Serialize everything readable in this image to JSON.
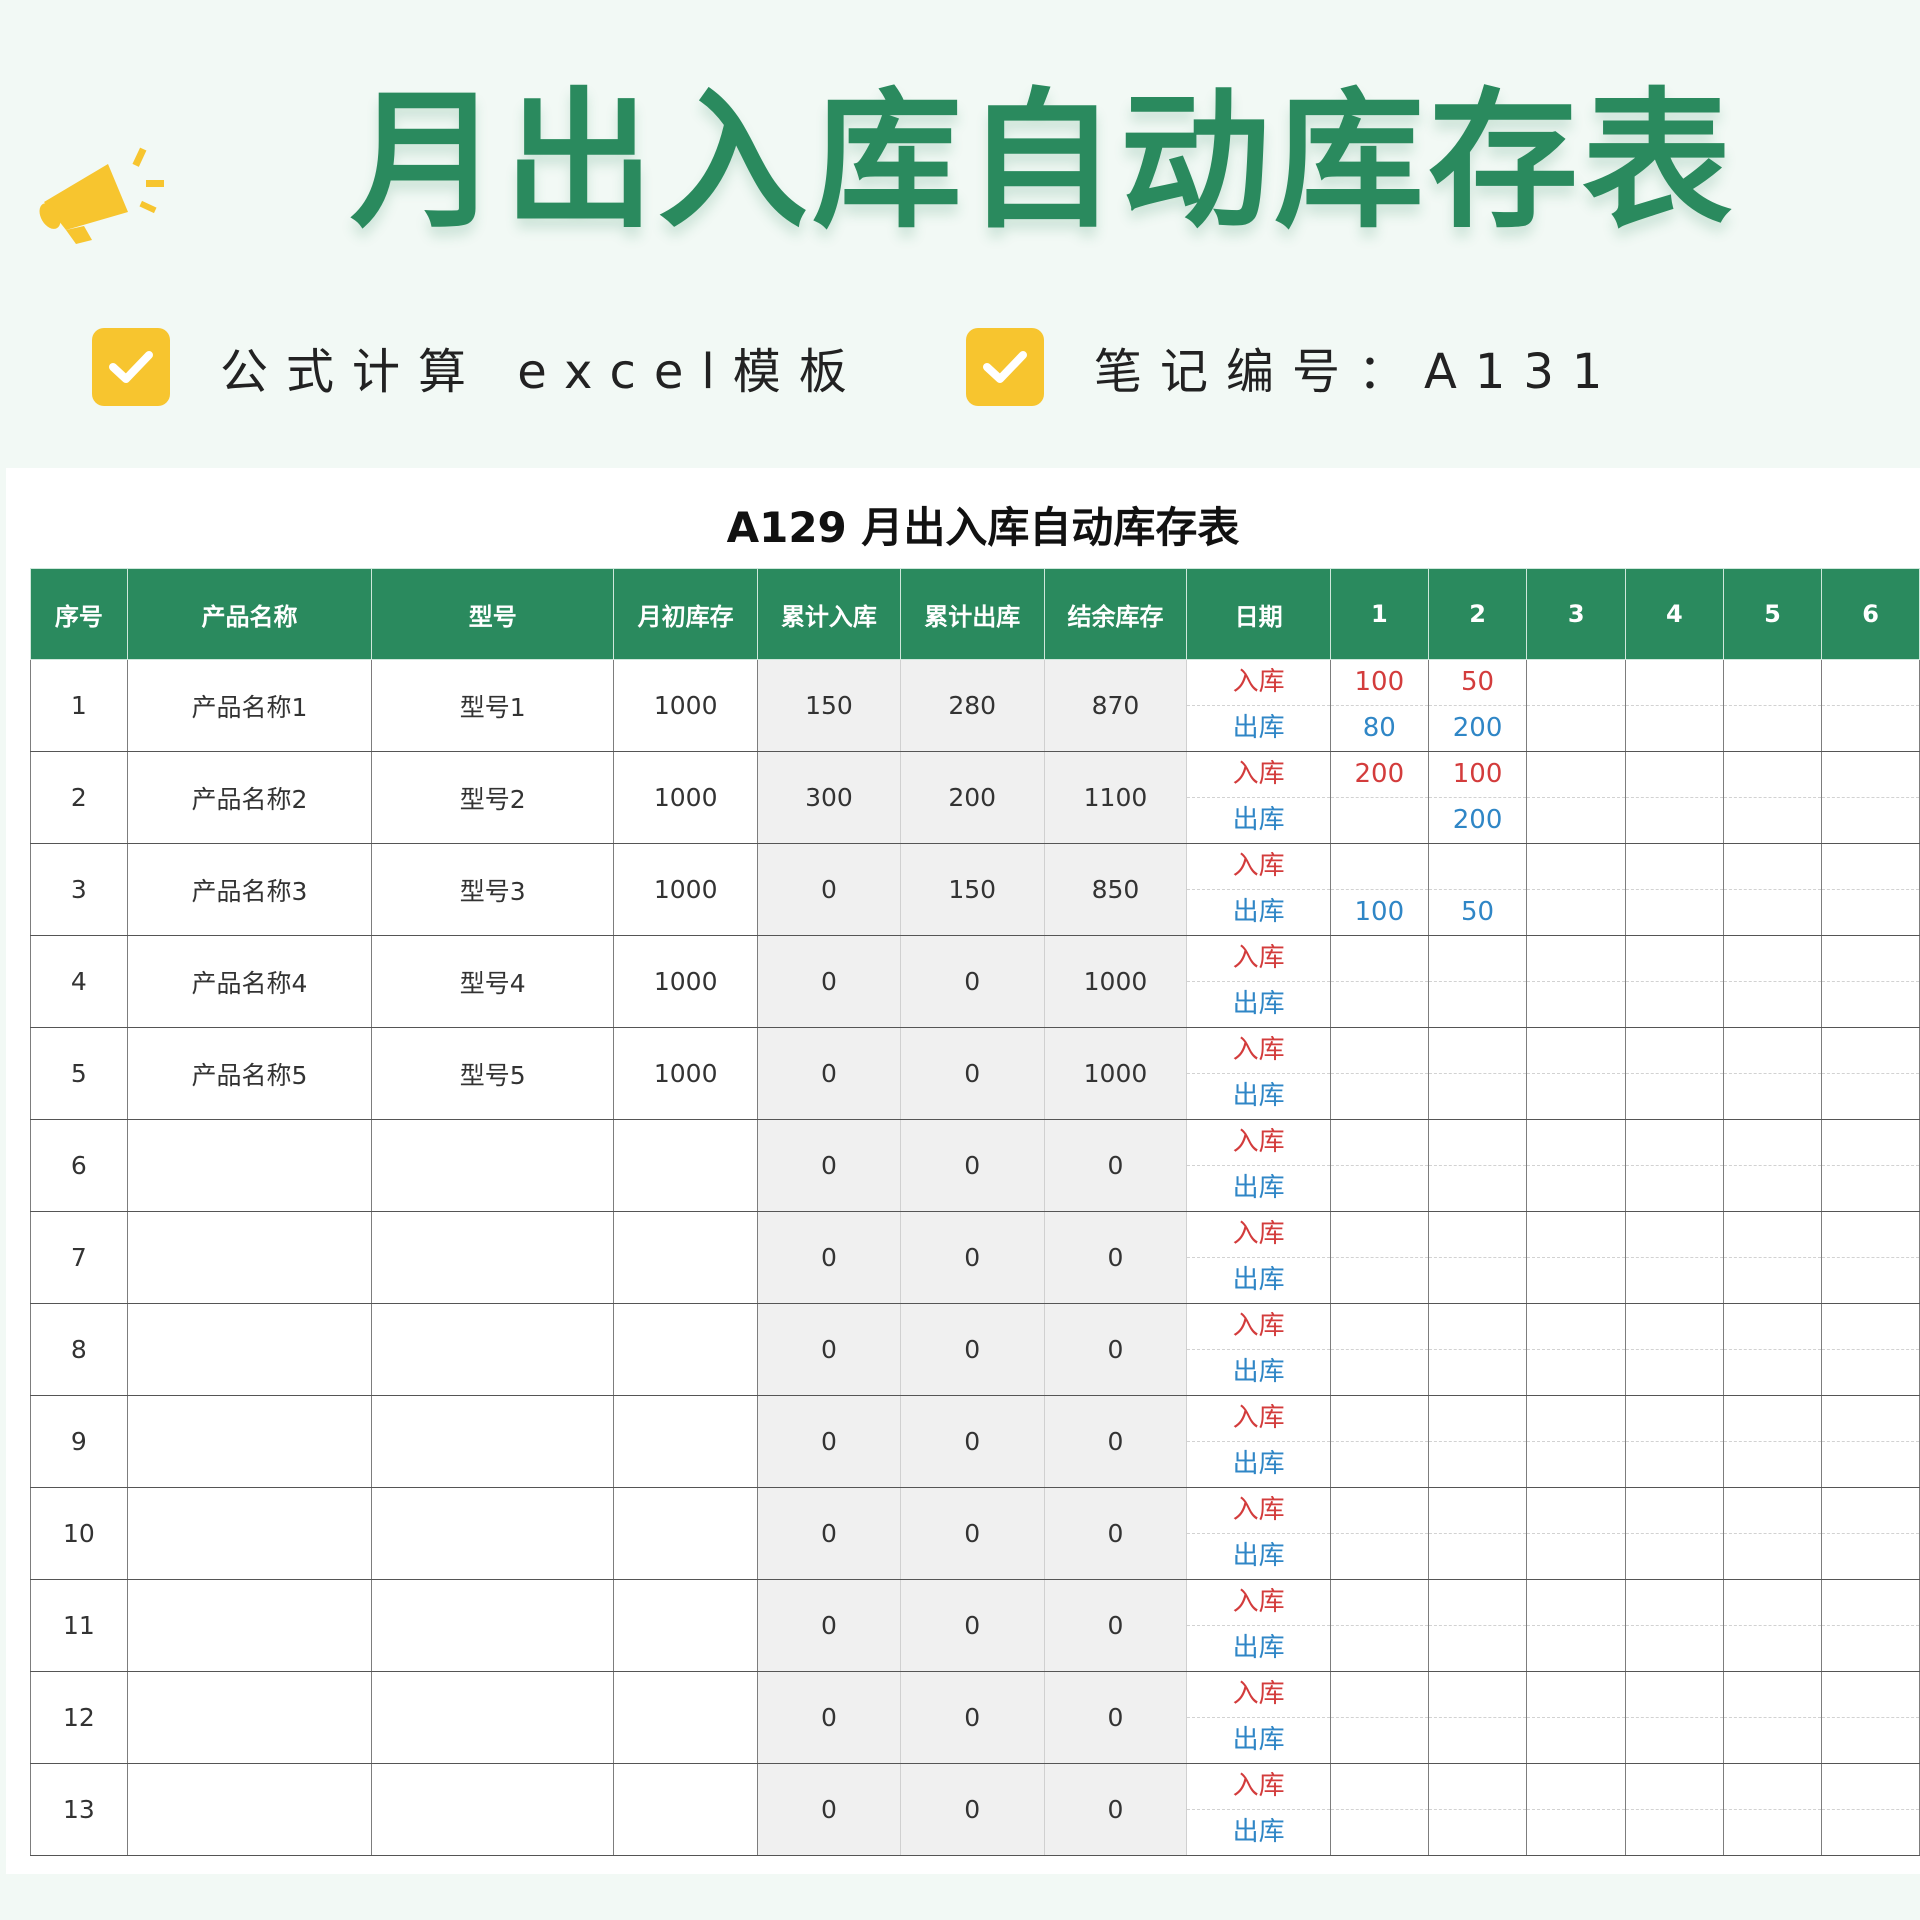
{
  "banner": {
    "title": "月出入库自动库存表",
    "tag_left": "公式计算 excel模板",
    "tag_right": "笔记编号：A131"
  },
  "sheet": {
    "title": "A129 月出入库自动库存表",
    "headers": [
      "序号",
      "产品名称",
      "型号",
      "月初库存",
      "累计入库",
      "累计出库",
      "结余库存",
      "日期",
      "1",
      "2",
      "3",
      "4",
      "5",
      "6"
    ],
    "in_label": "入库",
    "out_label": "出库",
    "rows": [
      {
        "seq": "1",
        "name": "产品名称1",
        "model": "型号1",
        "opening": "1000",
        "total_in": "150",
        "total_out": "280",
        "balance": "870",
        "day1_in": "100",
        "day1_out": "80",
        "day2_in": "50",
        "day2_out": "200"
      },
      {
        "seq": "2",
        "name": "产品名称2",
        "model": "型号2",
        "opening": "1000",
        "total_in": "300",
        "total_out": "200",
        "balance": "1100",
        "day1_in": "200",
        "day1_out": "",
        "day2_in": "100",
        "day2_out": "200"
      },
      {
        "seq": "3",
        "name": "产品名称3",
        "model": "型号3",
        "opening": "1000",
        "total_in": "0",
        "total_out": "150",
        "balance": "850",
        "day1_in": "",
        "day1_out": "100",
        "day2_in": "",
        "day2_out": "50"
      },
      {
        "seq": "4",
        "name": "产品名称4",
        "model": "型号4",
        "opening": "1000",
        "total_in": "0",
        "total_out": "0",
        "balance": "1000",
        "day1_in": "",
        "day1_out": "",
        "day2_in": "",
        "day2_out": ""
      },
      {
        "seq": "5",
        "name": "产品名称5",
        "model": "型号5",
        "opening": "1000",
        "total_in": "0",
        "total_out": "0",
        "balance": "1000",
        "day1_in": "",
        "day1_out": "",
        "day2_in": "",
        "day2_out": ""
      },
      {
        "seq": "6",
        "name": "",
        "model": "",
        "opening": "",
        "total_in": "0",
        "total_out": "0",
        "balance": "0",
        "day1_in": "",
        "day1_out": "",
        "day2_in": "",
        "day2_out": ""
      },
      {
        "seq": "7",
        "name": "",
        "model": "",
        "opening": "",
        "total_in": "0",
        "total_out": "0",
        "balance": "0",
        "day1_in": "",
        "day1_out": "",
        "day2_in": "",
        "day2_out": ""
      },
      {
        "seq": "8",
        "name": "",
        "model": "",
        "opening": "",
        "total_in": "0",
        "total_out": "0",
        "balance": "0",
        "day1_in": "",
        "day1_out": "",
        "day2_in": "",
        "day2_out": ""
      },
      {
        "seq": "9",
        "name": "",
        "model": "",
        "opening": "",
        "total_in": "0",
        "total_out": "0",
        "balance": "0",
        "day1_in": "",
        "day1_out": "",
        "day2_in": "",
        "day2_out": ""
      },
      {
        "seq": "10",
        "name": "",
        "model": "",
        "opening": "",
        "total_in": "0",
        "total_out": "0",
        "balance": "0",
        "day1_in": "",
        "day1_out": "",
        "day2_in": "",
        "day2_out": ""
      },
      {
        "seq": "11",
        "name": "",
        "model": "",
        "opening": "",
        "total_in": "0",
        "total_out": "0",
        "balance": "0",
        "day1_in": "",
        "day1_out": "",
        "day2_in": "",
        "day2_out": ""
      },
      {
        "seq": "12",
        "name": "",
        "model": "",
        "opening": "",
        "total_in": "0",
        "total_out": "0",
        "balance": "0",
        "day1_in": "",
        "day1_out": "",
        "day2_in": "",
        "day2_out": ""
      },
      {
        "seq": "13",
        "name": "",
        "model": "",
        "opening": "",
        "total_in": "0",
        "total_out": "0",
        "balance": "0",
        "day1_in": "",
        "day1_out": "",
        "day2_in": "",
        "day2_out": ""
      }
    ]
  },
  "colors": {
    "header_green": "#2a8a5e",
    "in_red": "#d33c3c",
    "out_blue": "#2f86c6",
    "check_yellow": "#f7c52f"
  }
}
